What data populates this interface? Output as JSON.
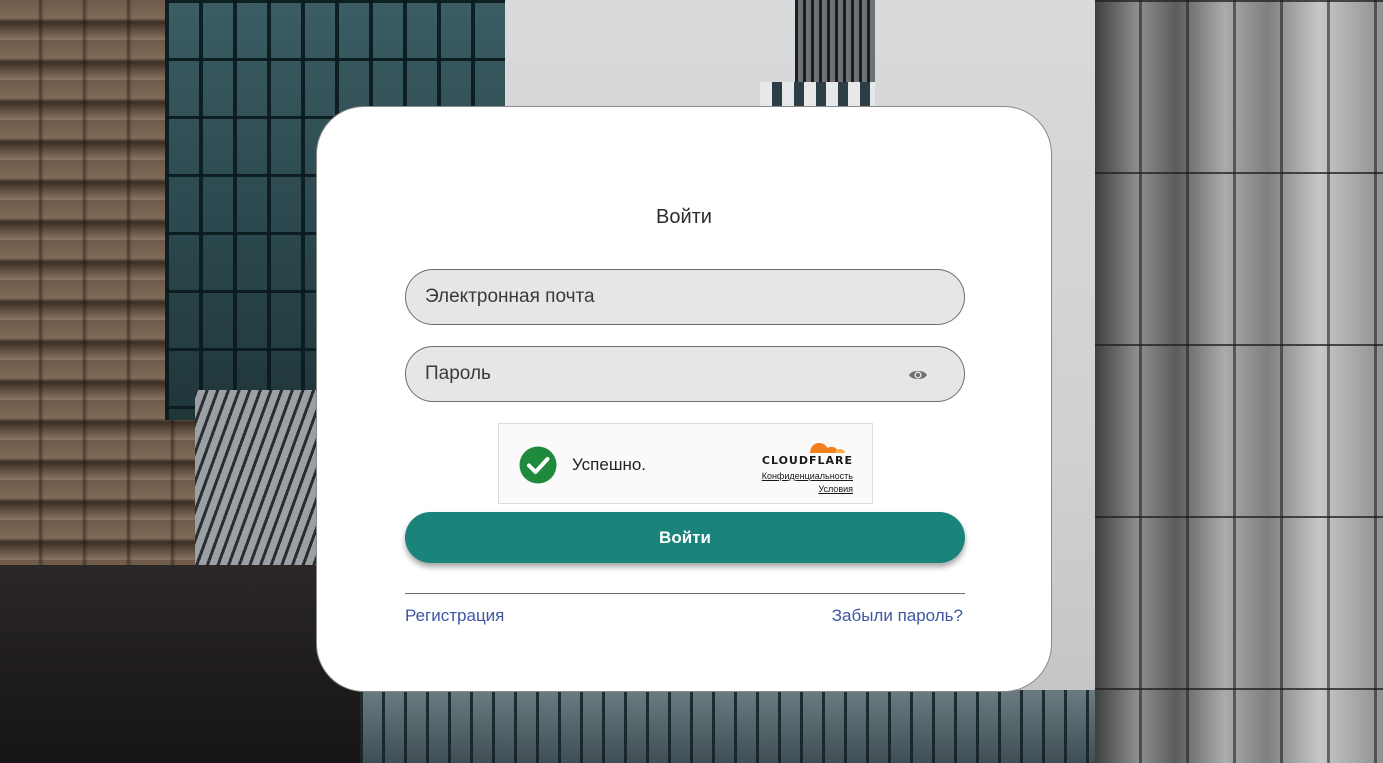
{
  "login": {
    "title": "Войти",
    "email_placeholder": "Электронная почта",
    "password_placeholder": "Пароль",
    "submit_label": "Войти",
    "register_link": "Регистрация",
    "forgot_link": "Забыли пароль?"
  },
  "captcha": {
    "status": "Успешно.",
    "brand": "CLOUDFLARE",
    "privacy_link": "Конфиденциальность",
    "terms_link": "Условия",
    "status_icon": "checkmark-circle-icon",
    "logo_icon": "cloudflare-cloud-icon"
  },
  "icons": {
    "password_toggle": "eye-icon"
  },
  "colors": {
    "primary_button": "#1a847a",
    "link": "#3e56a5",
    "success": "#1f8a3b",
    "cloudflare_orange": "#f38020"
  }
}
